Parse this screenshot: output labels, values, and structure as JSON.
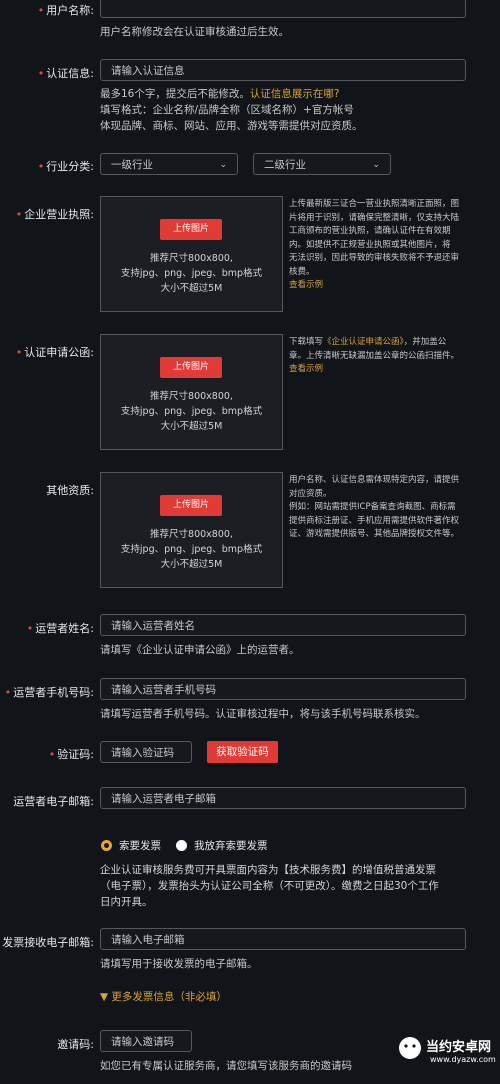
{
  "username": {
    "label": "用户名称:",
    "value": "",
    "hint": "用户名称修改会在认证审核通过后生效。"
  },
  "cert_info": {
    "label": "认证信息:",
    "placeholder": "请输入认证信息",
    "hint1_a": "最多16个字，提交后不能修改。",
    "hint1_link": "认证信息展示在哪?",
    "hint2": "填写格式：企业名称/品牌全称（区域名称）+官方帐号",
    "hint3": "体现品牌、商标、网站、应用、游戏等需提供对应资质。"
  },
  "industry": {
    "label": "行业分类:",
    "first": "一级行业",
    "second": "二级行业"
  },
  "business_license": {
    "label": "企业营业执照:",
    "upload": "上传图片",
    "spec1": "推荐尺寸800x800,",
    "spec2": "支持jpg、png、jpeg、bmp格式",
    "spec3": "大小不超过5M",
    "side1": "上传最新版三证合一营业执照清晰正面照，图",
    "side2": "片将用于识别，请确保完整清晰，仅支持大陆",
    "side3": "工商颁布的营业执照，请确认证件在有效期",
    "side4": "内。如提供不正规营业执照或其他图片，将",
    "side5": "无法识别，因此导致的审核失败将不予退还审",
    "side6": "核费。",
    "example": "查看示例"
  },
  "application_letter": {
    "label": "认证申请公函:",
    "upload": "上传图片",
    "spec1": "推荐尺寸800x800,",
    "spec2": "支持jpg、png、jpeg、bmp格式",
    "spec3": "大小不超过5M",
    "side1_a": "下载填写",
    "side1_link": "《企业认证申请公函》",
    "side1_b": "，并加盖公",
    "side2": "章。上传清晰无缺漏加盖公章的公函扫描件。",
    "example": "查看示例"
  },
  "other_qual": {
    "label": "其他资质:",
    "upload": "上传图片",
    "spec1": "推荐尺寸800x800,",
    "spec2": "支持jpg、png、jpeg、bmp格式",
    "spec3": "大小不超过5M",
    "side1": "用户名称、认证信息需体现特定内容，请提供",
    "side2": "对应资质。",
    "side3": "例如：网站需提供ICP备案查询截图、商标需",
    "side4": "提供商标注册证、手机应用需提供软件著作权",
    "side5": "证、游戏需提供版号、其他品牌授权文件等。"
  },
  "operator_name": {
    "label": "运营者姓名:",
    "placeholder": "请输入运营者姓名",
    "hint": "请填写《企业认证申请公函》上的运营者。"
  },
  "operator_phone": {
    "label": "运营者手机号码:",
    "placeholder": "请输入运营者手机号码",
    "hint": "请填写运营者手机号码。认证审核过程中，将与该手机号码联系核实。"
  },
  "verify_code": {
    "label": "验证码:",
    "placeholder": "请输入验证码",
    "button": "获取验证码"
  },
  "operator_email": {
    "label": "运营者电子邮箱:",
    "placeholder": "请输入运营者电子邮箱"
  },
  "invoice": {
    "opt_yes": "索要发票",
    "opt_no": "我放弃索要发票",
    "desc1": "企业认证审核服务费可开具票面内容为【技术服务费】的增值税普通发票",
    "desc2": "（电子票），发票抬头为认证公司全称（不可更改）。缴费之日起30个工作",
    "desc3": "日内开具。"
  },
  "invoice_email": {
    "label": "发票接收电子邮箱:",
    "placeholder": "请输入电子邮箱",
    "hint": "请填写用于接收发票的电子邮箱。"
  },
  "more_invoice": {
    "label": "更多发票信息（非必填）"
  },
  "invite_code": {
    "label": "邀请码:",
    "placeholder": "请输入邀请码",
    "hint": "如您已有专属认证服务商，请您填写该服务商的邀请码"
  },
  "watermark": {
    "brand": "当约安卓网",
    "url": "www.dyazw.com"
  },
  "colors": {
    "accent_red": "#e03b36",
    "link_gold": "#d9a43a",
    "bg": "#111418"
  }
}
